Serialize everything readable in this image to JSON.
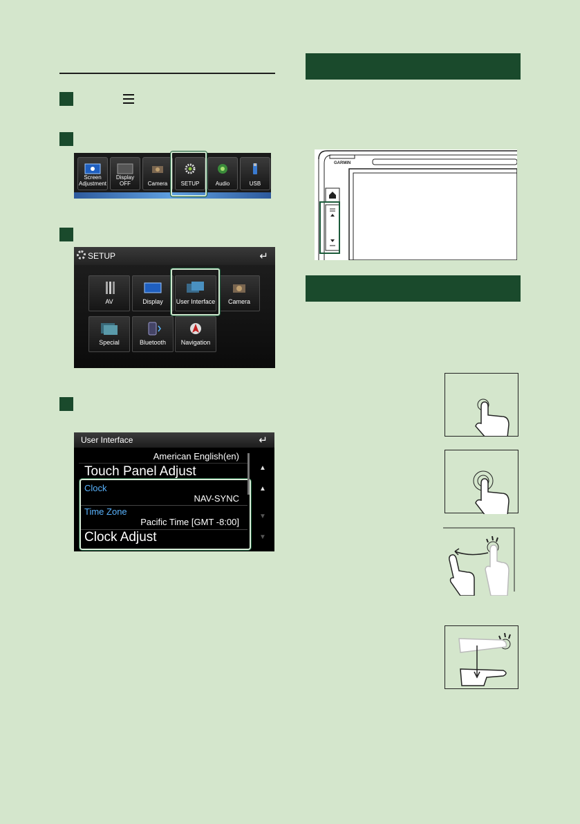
{
  "quick_menu": {
    "items": [
      {
        "label_line1": "Screen",
        "label_line2": "Adjustment"
      },
      {
        "label_line1": "Display OFF",
        "label_line2": ""
      },
      {
        "label_line1": "Camera",
        "label_line2": ""
      },
      {
        "label_line1": "SETUP",
        "label_line2": ""
      },
      {
        "label_line1": "Audio",
        "label_line2": ""
      },
      {
        "label_line1": "USB",
        "label_line2": ""
      }
    ]
  },
  "setup_screen": {
    "title": "SETUP",
    "buttons": [
      {
        "label": "AV"
      },
      {
        "label": "Display"
      },
      {
        "label": "User Interface"
      },
      {
        "label": "Camera"
      },
      {
        "label": "Special"
      },
      {
        "label": "Bluetooth"
      },
      {
        "label": "Navigation"
      }
    ]
  },
  "user_interface_screen": {
    "title": "User Interface",
    "language_value": "American English(en)",
    "touch_panel_label": "Touch Panel Adjust",
    "clock_label": "Clock",
    "clock_value": "NAV-SYNC",
    "timezone_label": "Time Zone",
    "timezone_value": "Pacific Time [GMT -8:00]",
    "clock_adjust_label": "Clock Adjust"
  },
  "device": {
    "brand": "GARMIN"
  },
  "colors": {
    "page_bg": "#d4e6cc",
    "banner": "#1a4a2c",
    "highlight": "#5ab4ff"
  }
}
